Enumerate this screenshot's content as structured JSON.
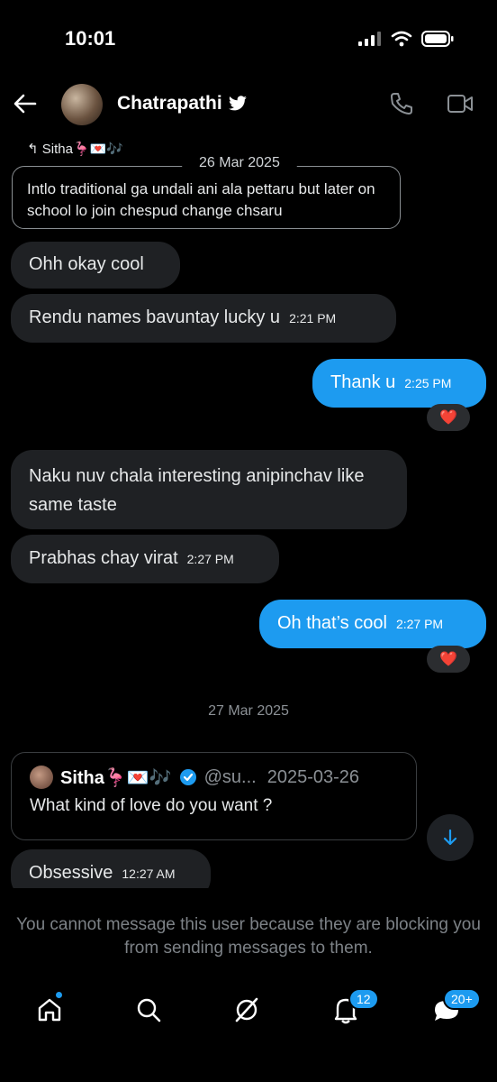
{
  "status_bar": {
    "time": "10:01"
  },
  "header": {
    "name": "Chatrapathi"
  },
  "conversation": {
    "reply_label": "Sitha🦩💌🎶",
    "date_1": "26 Mar 2025",
    "quoted_text": "Intlo traditional ga undali ani ala pettaru but later on school lo join chespud change chsaru",
    "messages": [
      {
        "text": "Ohh okay cool",
        "time": ""
      },
      {
        "text": "Rendu names bavuntay lucky u",
        "time": "2:21 PM"
      },
      {
        "text": "Thank u",
        "time": "2:25 PM"
      },
      {
        "text": "Naku nuv chala interesting anipinchav like same taste",
        "time": ""
      },
      {
        "text": "Prabhas chay virat",
        "time": "2:27 PM"
      },
      {
        "text": "Oh that’s cool",
        "time": "2:27 PM"
      },
      {
        "text": "Obsessive",
        "time": "12:27 AM"
      }
    ],
    "reaction": "❤️",
    "date_2": "27 Mar 2025",
    "tweet": {
      "name": "Sitha🦩💌🎶",
      "handle": "@su...",
      "date": "2025-03-26",
      "text": "What kind of love do you want ?"
    }
  },
  "notice": "You cannot message this user because they are blocking you from sending messages to them.",
  "nav": {
    "notifications_badge": "12",
    "messages_badge": "20+"
  },
  "colors": {
    "accent": "#1d9bf0",
    "incoming_bubble": "#1f2124",
    "background": "#000000"
  }
}
